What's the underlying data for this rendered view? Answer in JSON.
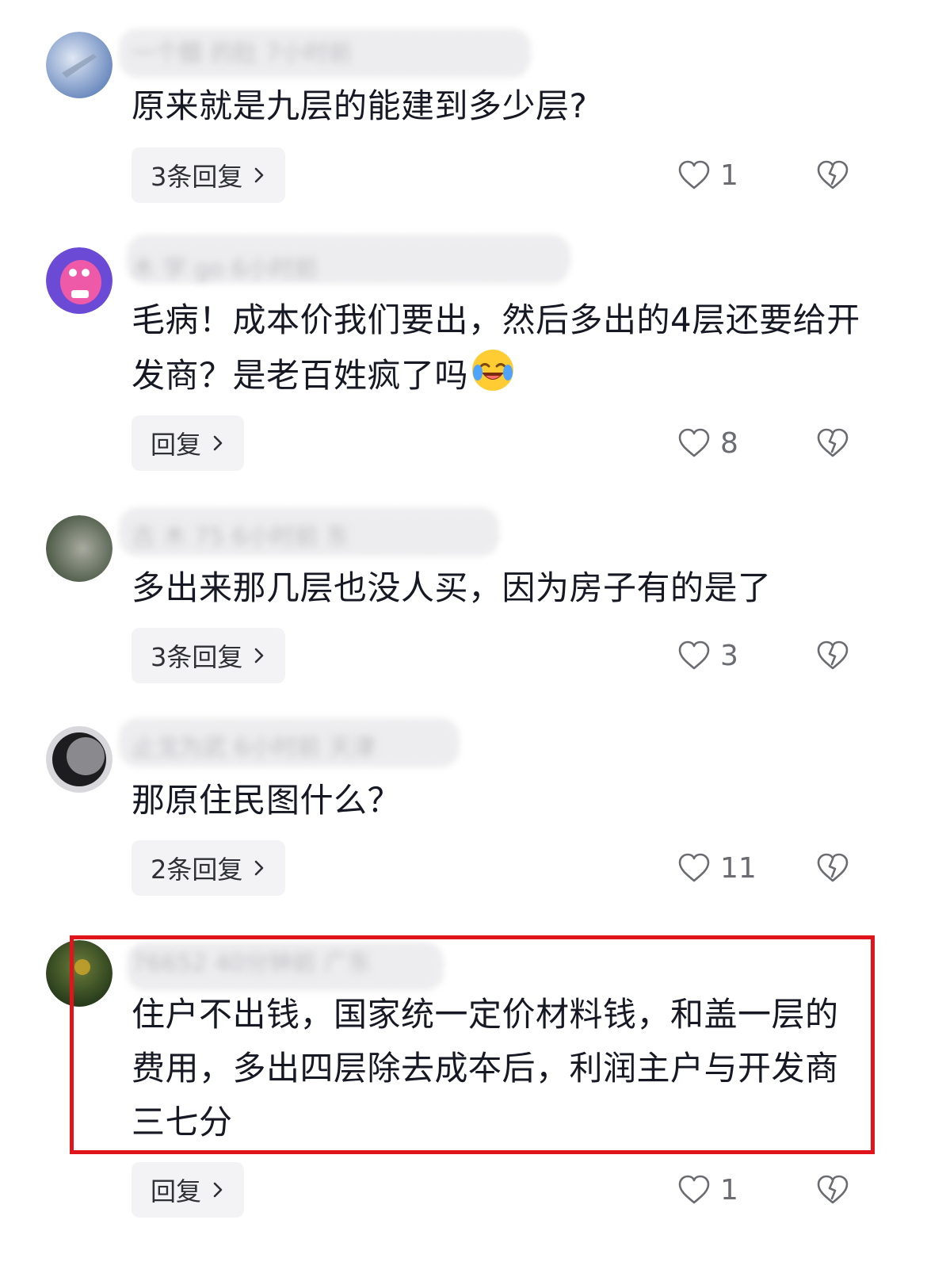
{
  "comments": [
    {
      "meta": "一个醋 的肚 7小时前",
      "text": "原来就是九层的能建到多少层?",
      "reply_label": "3条回复",
      "likes": "1",
      "avatar_colors": [
        "#6f8fc4",
        "#c9d6ea"
      ]
    },
    {
      "meta": "木 学 go 6小时前",
      "text": "毛病！成本价我们要出，然后多出的4层还要给开发商？是老百姓疯了吗",
      "reply_label": "回复",
      "likes": "8",
      "avatar_colors": [
        "#6b4bd6",
        "#ef5aa8"
      ]
    },
    {
      "meta": "古 木 75 6小时前 东",
      "text": "多出来那几层也没人买，因为房子有的是了",
      "reply_label": "3条回复",
      "likes": "3",
      "avatar_colors": [
        "#4d5a48",
        "#9aa394"
      ]
    },
    {
      "meta": "止戈为武 6小时前 天津",
      "text": "那原住民图什么？",
      "reply_label": "2条回复",
      "likes": "11",
      "avatar_colors": [
        "#1d1d1f",
        "#8a8a8e"
      ]
    },
    {
      "meta": "76652 40分钟前 广东",
      "text": "住户不出钱，国家统一定价材料钱，和盖一层的费用，多出四层除去成夲后，利润主户与开发商三七分",
      "reply_label": "回复",
      "likes": "1",
      "avatar_colors": [
        "#2f4a22",
        "#9a8a2a"
      ]
    }
  ],
  "colors": {
    "highlight": "#e0141b",
    "reply_bg": "#f3f3f5",
    "icon": "#6b6c72"
  },
  "icons": {
    "like": "heart-outline-icon",
    "dislike": "broken-heart-icon",
    "reply_chevron": "chevron-right-icon",
    "emoji": "laughing-crying-emoji"
  }
}
